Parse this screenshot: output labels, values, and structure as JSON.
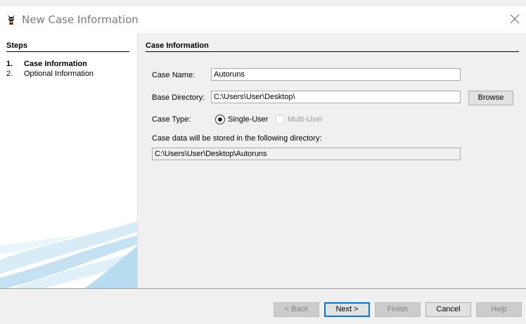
{
  "window": {
    "title": "New Case Information",
    "app_icon": "autopsy-dog-icon",
    "close_icon": "close-icon"
  },
  "steps": {
    "title": "Steps",
    "items": [
      {
        "number": "1.",
        "label": "Case Information",
        "active": true
      },
      {
        "number": "2.",
        "label": "Optional Information",
        "active": false
      }
    ]
  },
  "case_info": {
    "title": "Case Information",
    "case_name_label": "Case Name:",
    "case_name_value": "Autoruns",
    "base_dir_label": "Base Directory:",
    "base_dir_value": "C:\\Users\\User\\Desktop\\",
    "browse_label": "Browse",
    "case_type_label": "Case Type:",
    "single_user_label": "Single-User",
    "multi_user_label": "Multi-User",
    "case_type_selected": "Single-User",
    "storage_label": "Case data will be stored in the following directory:",
    "storage_value": "C:\\Users\\User\\Desktop\\Autoruns"
  },
  "footer": {
    "back_label": "< Back",
    "next_label": "Next >",
    "finish_label": "Finish",
    "cancel_label": "Cancel",
    "help_label": "Help"
  }
}
